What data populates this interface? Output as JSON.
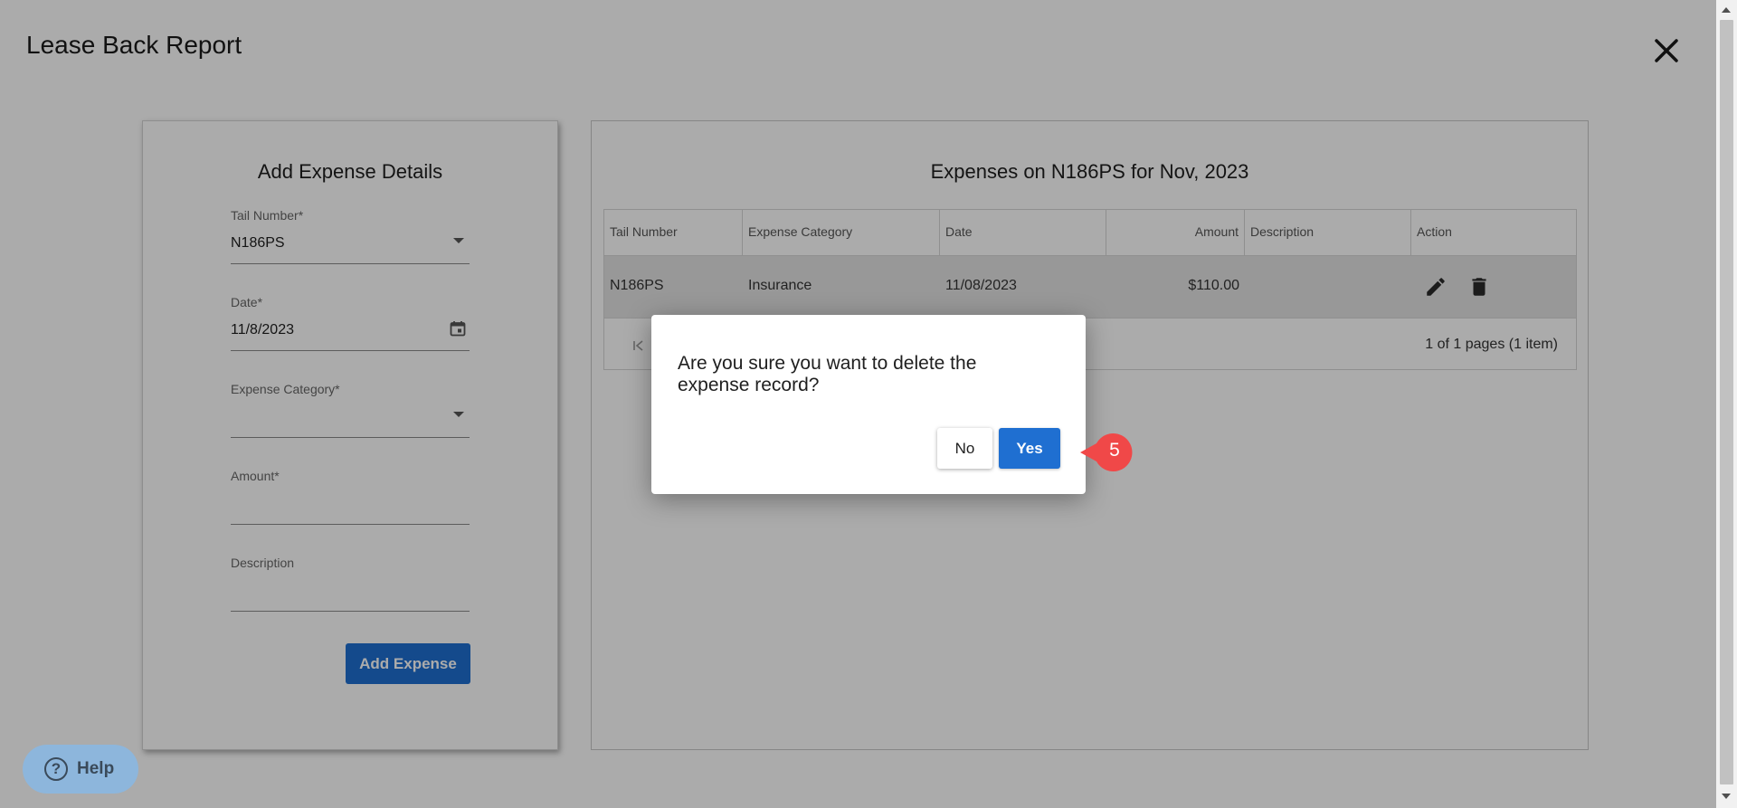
{
  "page": {
    "title": "Lease Back Report"
  },
  "form": {
    "title": "Add Expense Details",
    "tail_number": {
      "label": "Tail Number*",
      "value": "N186PS"
    },
    "date": {
      "label": "Date*",
      "value": "11/8/2023"
    },
    "expense_category": {
      "label": "Expense Category*",
      "value": ""
    },
    "amount": {
      "label": "Amount*",
      "value": ""
    },
    "description": {
      "label": "Description",
      "value": ""
    },
    "add_button": "Add Expense"
  },
  "grid": {
    "title": "Expenses on N186PS for Nov, 2023",
    "columns": [
      "Tail Number",
      "Expense Category",
      "Date",
      "Amount",
      "Description",
      "Action"
    ],
    "rows": [
      {
        "tail_number": "N186PS",
        "expense_category": "Insurance",
        "date": "11/08/2023",
        "amount": "$110.00",
        "description": ""
      }
    ],
    "pager_info": "1 of 1 pages (1 item)"
  },
  "dialog": {
    "message": "Are you sure you want to delete the expense record?",
    "no_label": "No",
    "yes_label": "Yes"
  },
  "annotation": {
    "step": "5"
  },
  "help": {
    "label": "Help",
    "icon_glyph": "?"
  },
  "colors": {
    "primary": "#1f6fd1",
    "help_bg": "#8db6dc",
    "annotation_red": "#f04848"
  }
}
